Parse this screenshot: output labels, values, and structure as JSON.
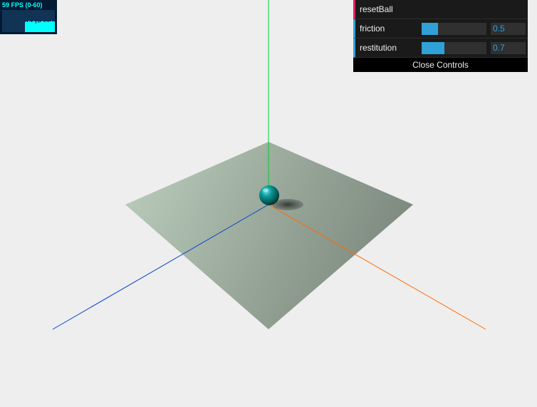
{
  "stats": {
    "fps_text": "59 FPS (0-60)",
    "fps_value": 59,
    "fps_min": 0,
    "fps_max": 60,
    "text_color": "#00ffff",
    "graph_color": "#00ffff"
  },
  "gui": {
    "controls": [
      {
        "type": "function",
        "label": "resetBall"
      },
      {
        "type": "number",
        "label": "friction",
        "value": "0.5",
        "fill_fraction": 0.25
      },
      {
        "type": "number",
        "label": "restitution",
        "value": "0.7",
        "fill_fraction": 0.35
      }
    ],
    "close_label": "Close Controls",
    "accent_function": "#e61d5f",
    "accent_number": "#2fa1d6"
  },
  "scene": {
    "background": "#eeeeee",
    "axis_colors": {
      "x": "#ff8000",
      "y": "#00cc33",
      "z": "#0044cc"
    },
    "plane_color": "#a7b8a8",
    "ball_color": "#008080"
  }
}
